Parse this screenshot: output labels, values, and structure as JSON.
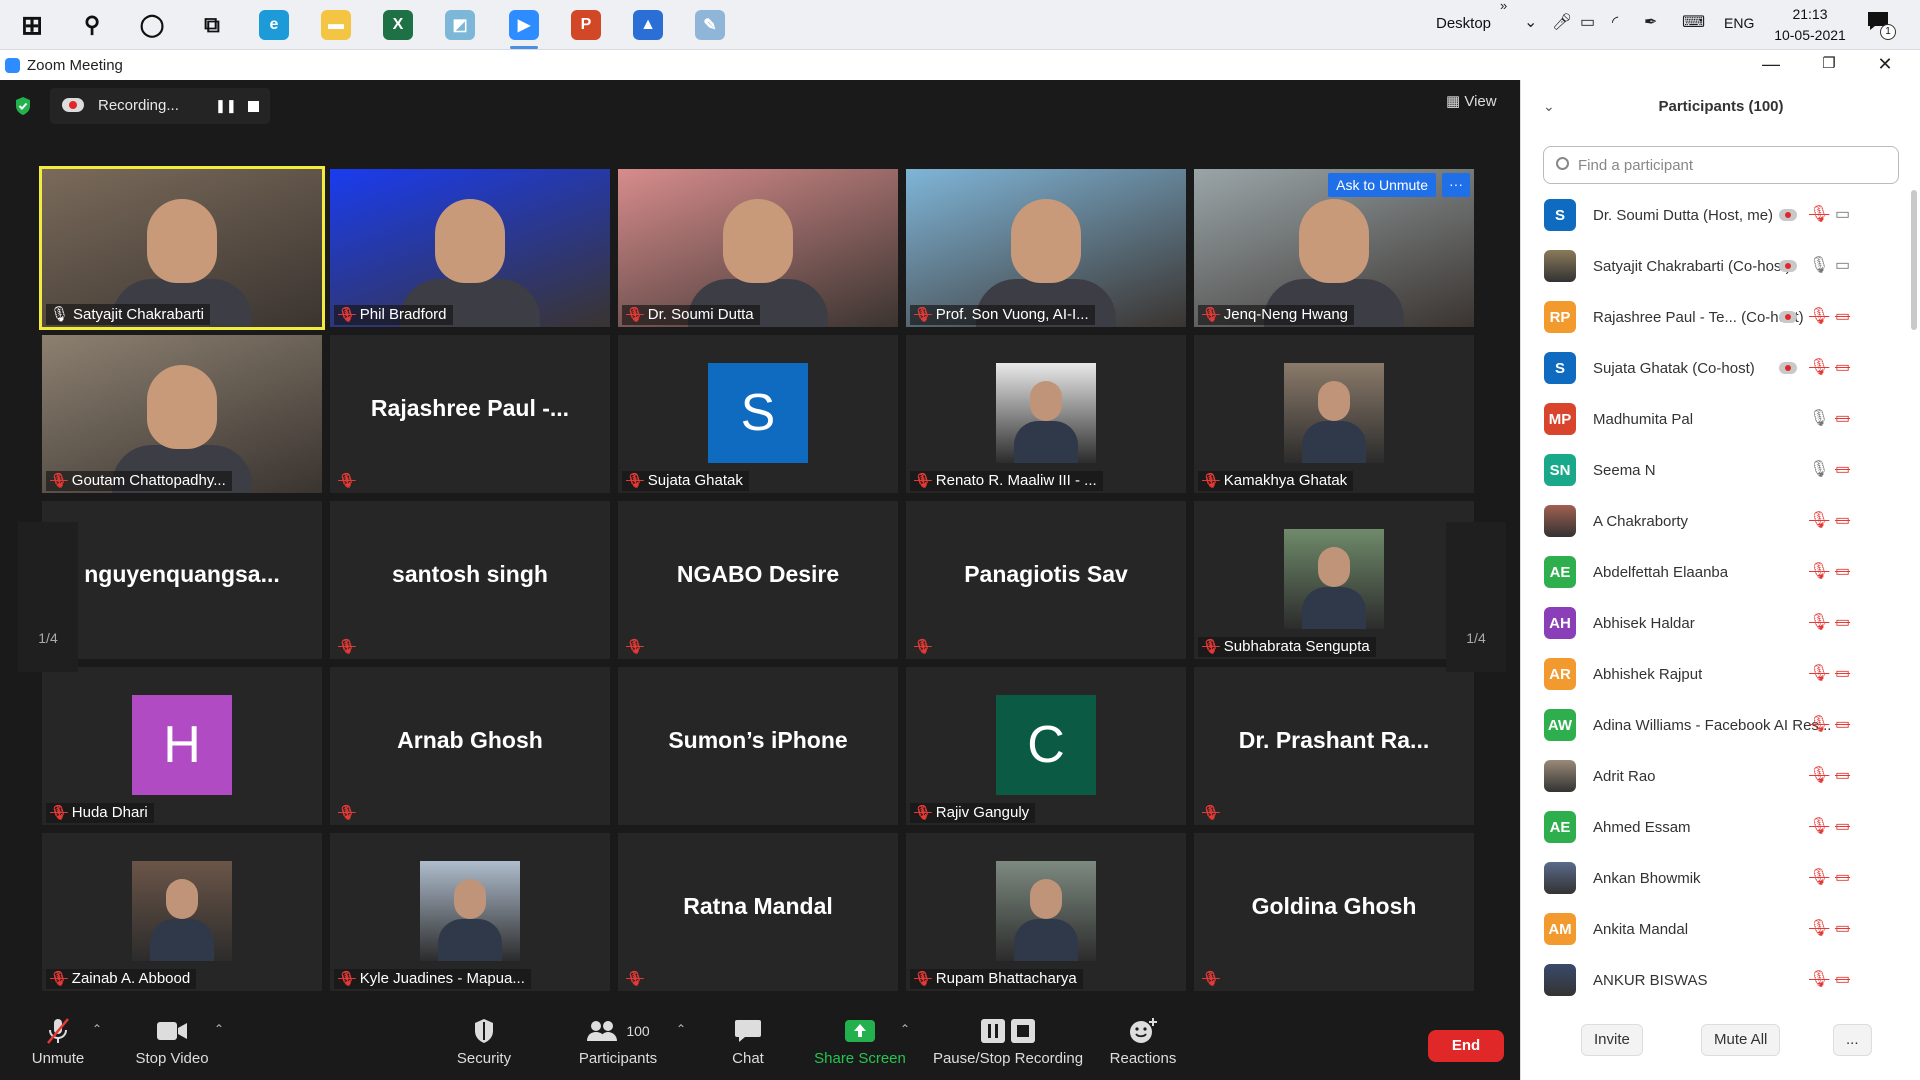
{
  "taskbar": {
    "apps": [
      {
        "name": "windows-start",
        "color": "#1a1a1a",
        "glyph": "⊞"
      },
      {
        "name": "search",
        "color": "#ffffff",
        "glyph": "⚲"
      },
      {
        "name": "cortana",
        "color": "#ffffff",
        "glyph": "◯"
      },
      {
        "name": "task-view",
        "color": "#ffffff",
        "glyph": "⧉"
      },
      {
        "name": "edge",
        "color": "#1d9bd8",
        "glyph": "e"
      },
      {
        "name": "file-explorer",
        "color": "#f4c542",
        "glyph": "▬"
      },
      {
        "name": "excel",
        "color": "#1e7145",
        "glyph": "X"
      },
      {
        "name": "app-blue",
        "color": "#7db7d8",
        "glyph": "◩"
      },
      {
        "name": "zoom",
        "color": "#2d8cff",
        "glyph": "▶"
      },
      {
        "name": "powerpoint",
        "color": "#d24726",
        "glyph": "P"
      },
      {
        "name": "photos",
        "color": "#2a6fd6",
        "glyph": "▲"
      },
      {
        "name": "paint",
        "color": "#8fb6d8",
        "glyph": "✎"
      }
    ],
    "desktop_label": "Desktop",
    "language": "ENG",
    "time": "21:13",
    "date": "10-05-2021",
    "notification_count": "1"
  },
  "window": {
    "title": "Zoom Meeting"
  },
  "meeting": {
    "recording_label": "Recording...",
    "view_label": "View",
    "page_left": "1/4",
    "page_right": "1/4",
    "tiles": [
      {
        "name": "Satyajit Chakrabarti",
        "kind": "video",
        "speaking": true,
        "muted": false,
        "bg": "#7a6a5a"
      },
      {
        "name": "Phil Bradford",
        "kind": "video",
        "muted": true,
        "bg": "#1a3cf0"
      },
      {
        "name": "Dr. Soumi Dutta",
        "kind": "video",
        "muted": true,
        "bg": "#d78c8c"
      },
      {
        "name": "Prof. Son Vuong, AI-I...",
        "kind": "video",
        "muted": true,
        "bg": "#7fb5d8"
      },
      {
        "name": "Jenq-Neng Hwang",
        "kind": "video",
        "muted": true,
        "bg": "#9aa5a8",
        "overlay": "Ask to Unmute"
      },
      {
        "name": "Goutam Chattopadhy...",
        "kind": "video",
        "muted": true,
        "bg": "#8c8070"
      },
      {
        "name": "",
        "bigname": "Rajashree  Paul  -...",
        "kind": "text",
        "muted": true
      },
      {
        "name": "Sujata Ghatak",
        "kind": "avatar",
        "letter": "S",
        "color": "#0e6bbf",
        "muted": true
      },
      {
        "name": "Renato R. Maaliw III - ...",
        "kind": "photo",
        "color": "#e9e9e9",
        "muted": true
      },
      {
        "name": "Kamakhya Ghatak",
        "kind": "photo",
        "color": "#8a7a6a",
        "muted": true
      },
      {
        "name": "",
        "bigname": "nguyenquangsa...",
        "kind": "text",
        "muted": false
      },
      {
        "name": "",
        "bigname": "santosh singh",
        "kind": "text",
        "muted": true
      },
      {
        "name": "",
        "bigname": "NGABO Desire",
        "kind": "text",
        "muted": true
      },
      {
        "name": "",
        "bigname": "Panagiotis Sav",
        "kind": "text",
        "muted": true
      },
      {
        "name": "Subhabrata Sengupta",
        "kind": "photo",
        "color": "#6f8a6a",
        "muted": true
      },
      {
        "name": "Huda Dhari",
        "kind": "avatar",
        "letter": "H",
        "color": "#b04bc4",
        "muted": true
      },
      {
        "name": "",
        "bigname": "Arnab Ghosh",
        "kind": "text",
        "muted": true
      },
      {
        "name": "",
        "bigname": "Sumon’s iPhone",
        "kind": "text",
        "muted": false
      },
      {
        "name": "Rajiv Ganguly",
        "kind": "avatar",
        "letter": "C",
        "color": "#0a5a44",
        "muted": true
      },
      {
        "name": "",
        "bigname": "Dr.  Prashant  Ra...",
        "kind": "text",
        "muted": true
      },
      {
        "name": "Zainab A. Abbood",
        "kind": "photo",
        "color": "#6b5548",
        "muted": true
      },
      {
        "name": "Kyle Juadines - Mapua...",
        "kind": "photo",
        "color": "#aebccc",
        "muted": true
      },
      {
        "name": "",
        "bigname": "Ratna Mandal",
        "kind": "text",
        "muted": true
      },
      {
        "name": "Rupam Bhattacharya",
        "kind": "photo",
        "color": "#7d8a80",
        "muted": true
      },
      {
        "name": "",
        "bigname": "Goldina Ghosh",
        "kind": "text",
        "muted": true
      }
    ]
  },
  "toolbar": {
    "unmute": "Unmute",
    "stop_video": "Stop Video",
    "security": "Security",
    "participants": "Participants",
    "participants_count": "100",
    "chat": "Chat",
    "share_screen": "Share Screen",
    "pause_stop_recording": "Pause/Stop Recording",
    "reactions": "Reactions",
    "end": "End"
  },
  "panel": {
    "title": "Participants (100)",
    "search_placeholder": "Find a participant",
    "invite": "Invite",
    "mute_all": "Mute All",
    "more": "...",
    "participants": [
      {
        "name": "Dr. Soumi Dutta (Host, me)",
        "initials": "S",
        "color": "#0e6bbf",
        "rec": true,
        "mic": "muted",
        "cam": "on"
      },
      {
        "name": "Satyajit Chakrabarti (Co-host)",
        "initials": "",
        "color": "#8a7a5a",
        "rec": true,
        "mic": "live",
        "cam": "on"
      },
      {
        "name": "Rajashree Paul - Te...  (Co-host)",
        "initials": "RP",
        "color": "#f29a2e",
        "rec": true,
        "mic": "muted",
        "cam": "off"
      },
      {
        "name": "Sujata Ghatak  (Co-host)",
        "initials": "S",
        "color": "#0e6bbf",
        "rec": true,
        "mic": "muted",
        "cam": "off"
      },
      {
        "name": "Madhumita Pal",
        "initials": "MP",
        "color": "#d9442c",
        "rec": false,
        "mic": "live",
        "cam": "off"
      },
      {
        "name": "Seema N",
        "initials": "SN",
        "color": "#1aa88a",
        "rec": false,
        "mic": "live",
        "cam": "off"
      },
      {
        "name": "A Chakraborty",
        "initials": "",
        "color": "#a06050",
        "rec": false,
        "mic": "muted",
        "cam": "off"
      },
      {
        "name": "Abdelfettah Elaanba",
        "initials": "AE",
        "color": "#2fae4e",
        "rec": false,
        "mic": "muted",
        "cam": "off"
      },
      {
        "name": "Abhisek Haldar",
        "initials": "AH",
        "color": "#8a3fb8",
        "rec": false,
        "mic": "muted",
        "cam": "off"
      },
      {
        "name": "Abhishek Rajput",
        "initials": "AR",
        "color": "#f29a2e",
        "rec": false,
        "mic": "muted",
        "cam": "off"
      },
      {
        "name": "Adina Williams - Facebook AI Res...",
        "initials": "AW",
        "color": "#2fae4e",
        "rec": false,
        "mic": "muted",
        "cam": "off"
      },
      {
        "name": "Adrit Rao",
        "initials": "",
        "color": "#9a8a78",
        "rec": false,
        "mic": "muted",
        "cam": "off"
      },
      {
        "name": "Ahmed Essam",
        "initials": "AE",
        "color": "#2fae4e",
        "rec": false,
        "mic": "muted",
        "cam": "off"
      },
      {
        "name": "Ankan Bhowmik",
        "initials": "",
        "color": "#5a6a8a",
        "rec": false,
        "mic": "muted",
        "cam": "off"
      },
      {
        "name": "Ankita Mandal",
        "initials": "AM",
        "color": "#f29a2e",
        "rec": false,
        "mic": "muted",
        "cam": "off"
      },
      {
        "name": "ANKUR BISWAS",
        "initials": "",
        "color": "#3a4a6a",
        "rec": false,
        "mic": "muted",
        "cam": "off"
      }
    ]
  }
}
